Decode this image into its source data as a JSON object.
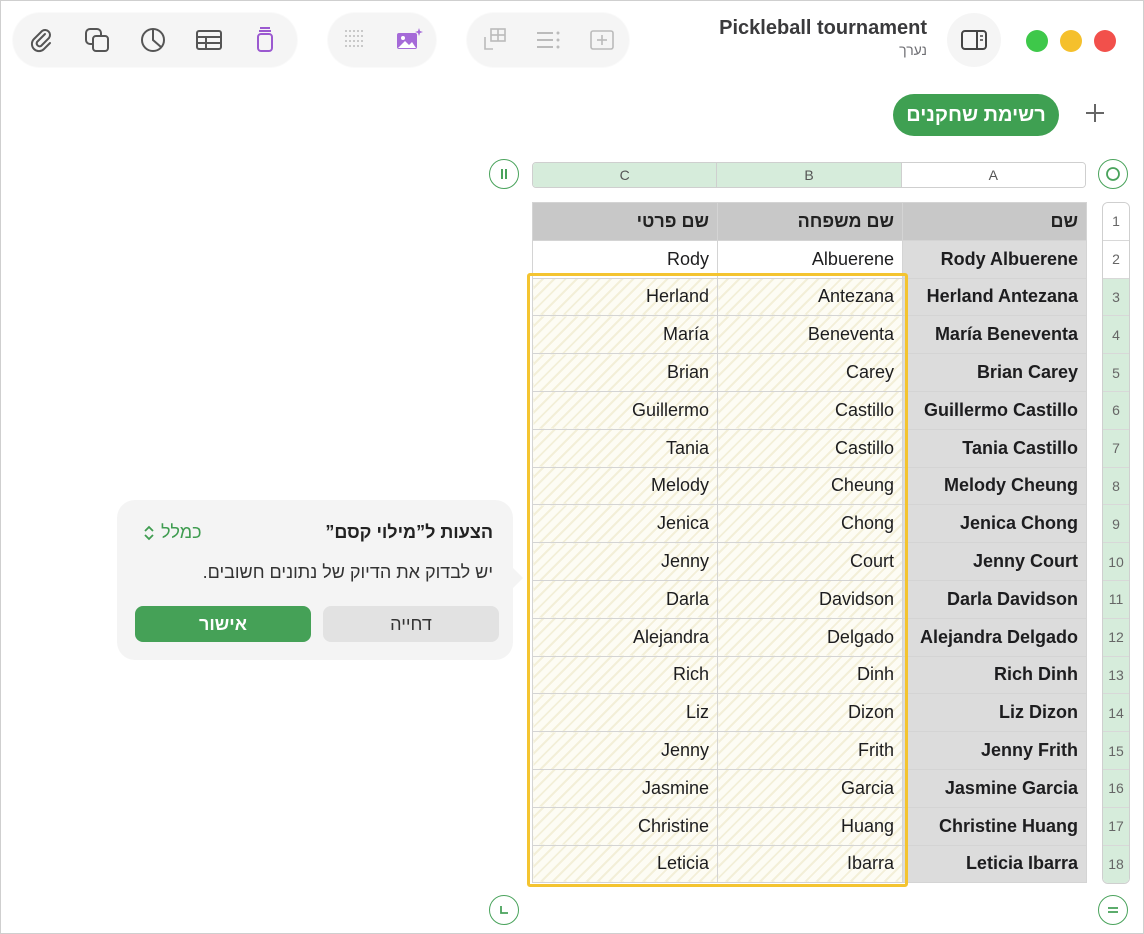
{
  "window": {
    "title": "Pickleball tournament",
    "subtitle": "נערך"
  },
  "toolbar": {
    "groups": [
      [
        "paperclip-icon",
        "shapes-icon",
        "chart-icon",
        "table-icon",
        "stack-icon"
      ],
      [
        "grid-dots-icon",
        "image-sparkle-icon"
      ],
      [
        "transpose-icon",
        "list-icon",
        "insert-box-icon"
      ]
    ]
  },
  "sheet": {
    "tab_label": "רשימת שחקנים"
  },
  "columns": [
    "C",
    "B",
    "A"
  ],
  "table": {
    "headers": {
      "first": "שם פרטי",
      "last": "שם משפחה",
      "full": "שם"
    },
    "rows": [
      {
        "n": "2",
        "first": "Rody",
        "last": "Albuerene",
        "full": "Rody Albuerene"
      },
      {
        "n": "3",
        "first": "Herland",
        "last": "Antezana",
        "full": "Herland Antezana"
      },
      {
        "n": "4",
        "first": "María",
        "last": "Beneventa",
        "full": "María Beneventa"
      },
      {
        "n": "5",
        "first": "Brian",
        "last": "Carey",
        "full": "Brian Carey"
      },
      {
        "n": "6",
        "first": "Guillermo",
        "last": "Castillo",
        "full": "Guillermo Castillo"
      },
      {
        "n": "7",
        "first": "Tania",
        "last": "Castillo",
        "full": "Tania Castillo"
      },
      {
        "n": "8",
        "first": "Melody",
        "last": "Cheung",
        "full": "Melody Cheung"
      },
      {
        "n": "9",
        "first": "Jenica",
        "last": "Chong",
        "full": "Jenica Chong"
      },
      {
        "n": "10",
        "first": "Jenny",
        "last": "Court",
        "full": "Jenny Court"
      },
      {
        "n": "11",
        "first": "Darla",
        "last": "Davidson",
        "full": "Darla Davidson"
      },
      {
        "n": "12",
        "first": "Alejandra",
        "last": "Delgado",
        "full": "Alejandra Delgado"
      },
      {
        "n": "13",
        "first": "Rich",
        "last": "Dinh",
        "full": "Rich Dinh"
      },
      {
        "n": "14",
        "first": "Liz",
        "last": "Dizon",
        "full": "Liz Dizon"
      },
      {
        "n": "15",
        "first": "Jenny",
        "last": "Frith",
        "full": "Jenny Frith"
      },
      {
        "n": "16",
        "first": "Jasmine",
        "last": "Garcia",
        "full": "Jasmine Garcia"
      },
      {
        "n": "17",
        "first": "Christine",
        "last": "Huang",
        "full": "Christine Huang"
      },
      {
        "n": "18",
        "first": "Leticia",
        "last": "Ibarra",
        "full": "Leticia Ibarra"
      }
    ]
  },
  "popover": {
    "title": "הצעות ל”מילוי קסם”",
    "more_label": "כמלל",
    "description": "יש לבדוק את הדיוק של נתונים חשובים.",
    "accept_label": "אישור",
    "reject_label": "דחייה"
  },
  "colors": {
    "accent": "#3fa052",
    "highlight_frame": "#f4c430",
    "traffic_green": "#3ec84a",
    "traffic_yellow": "#f5c02c",
    "traffic_red": "#f2504b"
  }
}
